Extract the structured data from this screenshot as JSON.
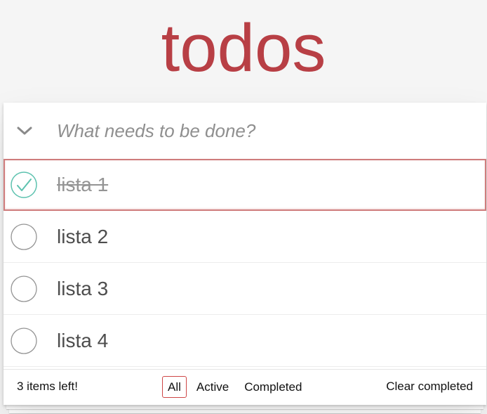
{
  "app": {
    "title": "todos"
  },
  "new_todo": {
    "placeholder": "What needs to be done?",
    "value": ""
  },
  "toggle_all_icon": "chevron-down-icon",
  "todos": [
    {
      "label": "lista 1",
      "completed": true
    },
    {
      "label": "lista 2",
      "completed": false
    },
    {
      "label": "lista 3",
      "completed": false
    },
    {
      "label": "lista 4",
      "completed": false
    }
  ],
  "footer": {
    "items_left": "3 items left!",
    "filters": [
      "All",
      "Active",
      "Completed"
    ],
    "selected_filter": "All",
    "clear_label": "Clear completed"
  },
  "colors": {
    "brand": "#b83f45",
    "check_done": "#5dc2af",
    "check_empty": "#949494",
    "selected_filter_border": "#ce4646"
  }
}
